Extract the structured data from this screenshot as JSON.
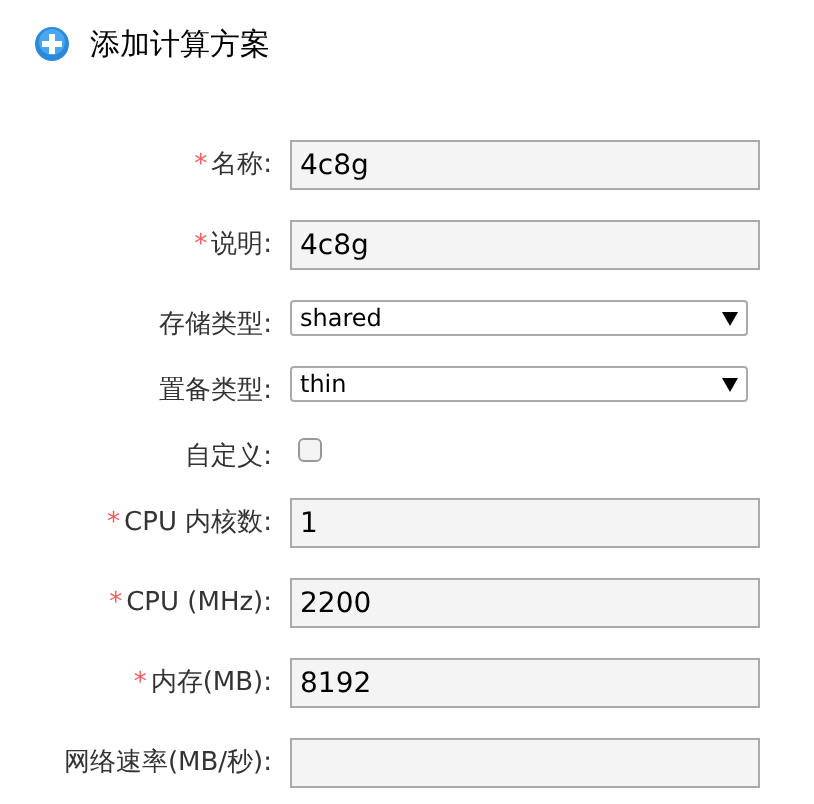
{
  "title": "添加计算方案",
  "fields": [
    {
      "kind": "text",
      "required_mark": "*",
      "label": "名称:",
      "value": "4c8g"
    },
    {
      "kind": "text",
      "required_mark": "*",
      "label": "说明:",
      "value": "4c8g"
    },
    {
      "kind": "select",
      "label": "存储类型:",
      "value": "shared"
    },
    {
      "kind": "select",
      "label": "置备类型:",
      "value": "thin"
    },
    {
      "kind": "checkbox",
      "label": "自定义:",
      "checked": false
    },
    {
      "kind": "text",
      "required_mark": "*",
      "label": "CPU 内核数:",
      "value": "1"
    },
    {
      "kind": "text",
      "required_mark": "*",
      "label": "CPU (MHz):",
      "value": "2200"
    },
    {
      "kind": "text",
      "required_mark": "*",
      "label": "内存(MB):",
      "value": "8192"
    },
    {
      "kind": "text",
      "label": "网络速率(MB/秒):"
    }
  ]
}
